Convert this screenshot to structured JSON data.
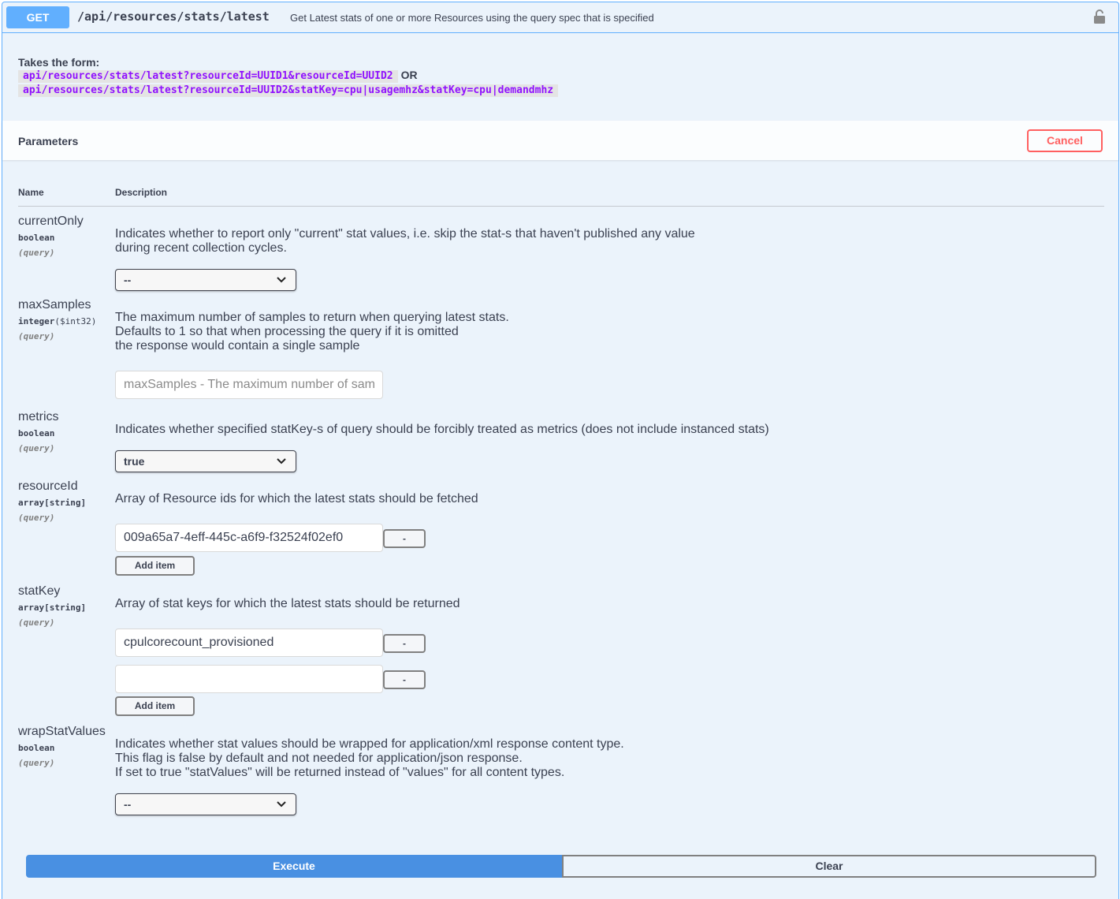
{
  "summary": {
    "method": "GET",
    "path": "/api/resources/stats/latest",
    "description": "Get Latest stats of one or more Resources using the query spec that is specified",
    "lock_icon": "lock-icon"
  },
  "description": {
    "title": "Takes the form:",
    "example1": "api/resources/stats/latest?resourceId=UUID1&resourceId=UUID2",
    "or": "OR",
    "example2": "api/resources/stats/latest?resourceId=UUID2&statKey=cpu|usagemhz&statKey=cpu|demandmhz"
  },
  "parameters": {
    "title": "Parameters",
    "cancel_label": "Cancel",
    "col_name": "Name",
    "col_description": "Description"
  },
  "params": {
    "currentOnly": {
      "name": "currentOnly",
      "type": "boolean",
      "in": "(query)",
      "desc1": "Indicates whether to report only \"current\" stat values, i.e. skip the stat-s that haven't published any value",
      "desc2": "during recent collection cycles.",
      "value": "--"
    },
    "maxSamples": {
      "name": "maxSamples",
      "type": "integer",
      "format": "($int32)",
      "in": "(query)",
      "desc1": "The maximum number of samples to return when querying latest stats.",
      "desc2": "Defaults to 1 so that when processing the query if it is omitted",
      "desc3": "the response would contain a single sample",
      "placeholder": "maxSamples - The maximum number of sam"
    },
    "metrics": {
      "name": "metrics",
      "type": "boolean",
      "in": "(query)",
      "desc1": "Indicates whether specified statKey-s of query should be forcibly treated as metrics (does not include instanced stats)",
      "value": "true"
    },
    "resourceId": {
      "name": "resourceId",
      "type": "array[string]",
      "in": "(query)",
      "desc1": "Array of Resource ids for which the latest stats should be fetched",
      "items": [
        "009a65a7-4eff-445c-a6f9-f32524f02ef0"
      ],
      "remove_label": "-",
      "add_label": "Add item"
    },
    "statKey": {
      "name": "statKey",
      "type": "array[string]",
      "in": "(query)",
      "desc1": "Array of stat keys for which the latest stats should be returned",
      "items": [
        "cpulcorecount_provisioned",
        ""
      ],
      "remove_label": "-",
      "add_label": "Add item"
    },
    "wrapStatValues": {
      "name": "wrapStatValues",
      "type": "boolean",
      "in": "(query)",
      "desc1": "Indicates whether stat values should be wrapped for application/xml response content type.",
      "desc2": "This flag is false by default and not needed for application/json response.",
      "desc3": "If set to true \"statValues\" will be returned instead of \"values\" for all content types.",
      "value": "--"
    }
  },
  "actions": {
    "execute_label": "Execute",
    "clear_label": "Clear"
  },
  "colors": {
    "get": "#61affe",
    "execute": "#4990e2",
    "cancel": "#ff6060",
    "background": "#ebf3fb"
  }
}
